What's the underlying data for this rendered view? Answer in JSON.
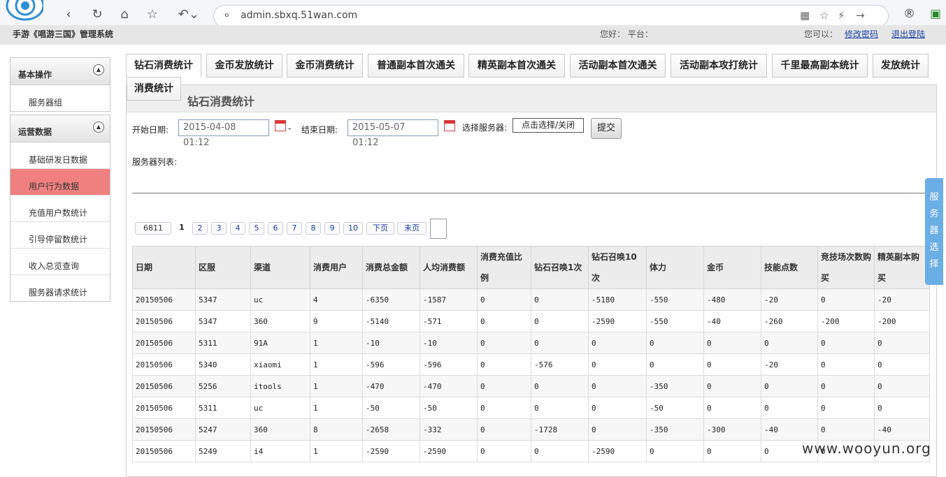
{
  "browser": {
    "url": "admin.sbxq.51wan.com"
  },
  "header": {
    "system_title": "手游《唱游三国》管理系统",
    "greeting": "您好：   平台：",
    "can_label": "您可以：",
    "change_password": "修改密码",
    "logout": "退出登陆"
  },
  "sidebar": {
    "groups": [
      {
        "title": "基本操作",
        "items": [
          "服务器组"
        ]
      },
      {
        "title": "运营数据",
        "items": [
          "基础研发日数据",
          "用户行为数据",
          "充值用户数统计",
          "引导停留数统计",
          "收入总览查询",
          "服务器请求统计"
        ],
        "active": 1
      }
    ]
  },
  "tabs": [
    "钻石消费统计",
    "金币发放统计",
    "金币消费统计",
    "普通副本首次通关",
    "精英副本首次通关",
    "活动副本首次通关",
    "活动副本攻打统计",
    "千里最高副本统计",
    "发放统计",
    "消费统计"
  ],
  "panel": {
    "title": "钻石消费统计",
    "start_label": "开始日期:",
    "start_value": "2015-04-08 01:12",
    "dash": "-",
    "end_label": "结束日期:",
    "end_value": "2015-05-07 01:12",
    "server_label": "选择服务器:",
    "server_button": "点击选择/关闭",
    "submit": "提交",
    "server_list_label": "服务器列表:"
  },
  "pager": {
    "total": "6811",
    "pages": [
      "1",
      "2",
      "3",
      "4",
      "5",
      "6",
      "7",
      "8",
      "9",
      "10"
    ],
    "next": "下页",
    "last": "末页"
  },
  "table": {
    "headers": [
      "日期",
      "区服",
      "渠道",
      "消费用户",
      "消费总金额",
      "人均消费额",
      "消费充值比例",
      "钻石召唤1次",
      "钻石召唤10次",
      "体力",
      "金币",
      "技能点数",
      "竞技场次数购买",
      "精英副本购买"
    ],
    "rows": [
      [
        "20150506",
        "5347",
        "uc",
        "4",
        "-6350",
        "-1587",
        "0",
        "0",
        "-5180",
        "-550",
        "-480",
        "-20",
        "0",
        "-20"
      ],
      [
        "20150506",
        "5347",
        "360",
        "9",
        "-5140",
        "-571",
        "0",
        "0",
        "-2590",
        "-550",
        "-40",
        "-260",
        "-200",
        "-200"
      ],
      [
        "20150506",
        "5311",
        "91A",
        "1",
        "-10",
        "-10",
        "0",
        "0",
        "0",
        "0",
        "0",
        "0",
        "0",
        "0"
      ],
      [
        "20150506",
        "5340",
        "xiaomi",
        "1",
        "-596",
        "-596",
        "0",
        "-576",
        "0",
        "0",
        "0",
        "-20",
        "0",
        "0"
      ],
      [
        "20150506",
        "5256",
        "itools",
        "1",
        "-470",
        "-470",
        "0",
        "0",
        "0",
        "-350",
        "0",
        "0",
        "0",
        "0"
      ],
      [
        "20150506",
        "5311",
        "uc",
        "1",
        "-50",
        "-50",
        "0",
        "0",
        "0",
        "-50",
        "0",
        "0",
        "0",
        "0"
      ],
      [
        "20150506",
        "5247",
        "360",
        "8",
        "-2658",
        "-332",
        "0",
        "-1728",
        "0",
        "-350",
        "-300",
        "-40",
        "0",
        "-40"
      ],
      [
        "20150506",
        "5249",
        "i4",
        "1",
        "-2590",
        "-2590",
        "0",
        "0",
        "-2590",
        "0",
        "0",
        "0",
        "0",
        ""
      ]
    ]
  },
  "float_panel": "服务器选择",
  "watermark": "www.wooyun.org"
}
